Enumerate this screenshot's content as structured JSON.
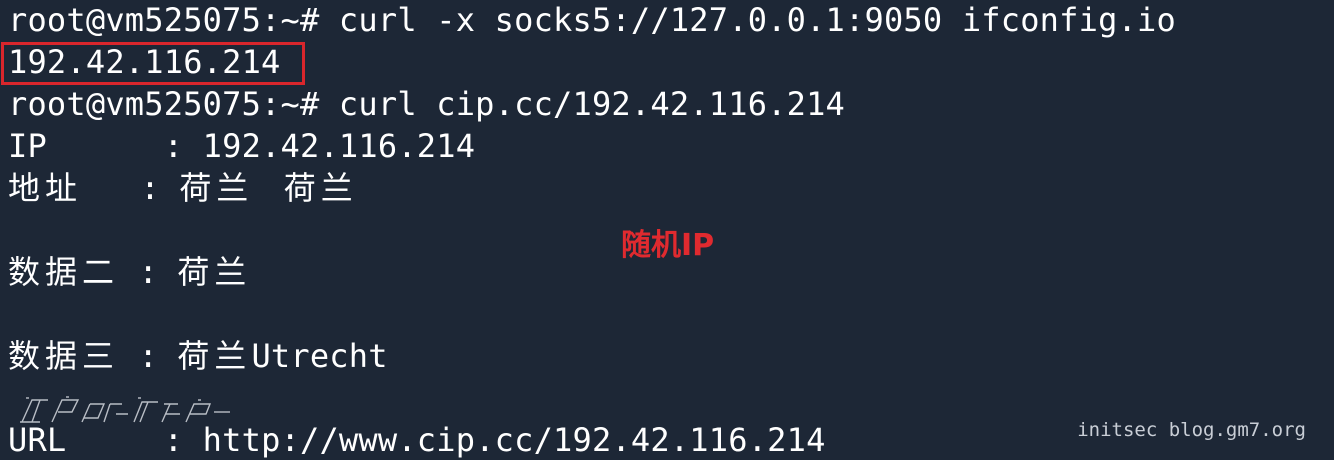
{
  "terminal": {
    "lines": [
      {
        "prompt": "root@vm525075:~#",
        "command": " curl -x socks5://127.0.0.1:9050 ifconfig.io"
      },
      {
        "output": "192.42.116.214"
      },
      {
        "prompt": "root@vm525075:~#",
        "command": " curl cip.cc/192.42.116.214"
      },
      {
        "label": "IP",
        "sep": "      : ",
        "value": "192.42.116.214"
      },
      {
        "label": "地址",
        "sep": "   : ",
        "value": "荷兰  荷兰"
      },
      {
        "label": "数据二",
        "sep": " : ",
        "value": "荷兰"
      },
      {
        "label": "数据三",
        "sep": " : ",
        "value": "荷兰",
        "value_suffix": "Utrecht"
      },
      {
        "label": "URL",
        "sep": "     : ",
        "value": "http://www.cip.cc/192.42.116.214"
      }
    ]
  },
  "annotation": {
    "text": "随机IP",
    "color": "#e02a2f"
  },
  "watermark": {
    "right_text": "initsec blog.gm7.org"
  },
  "colors": {
    "background": "#1d2736",
    "text": "#ffffff",
    "highlight_border": "#d9262c"
  }
}
